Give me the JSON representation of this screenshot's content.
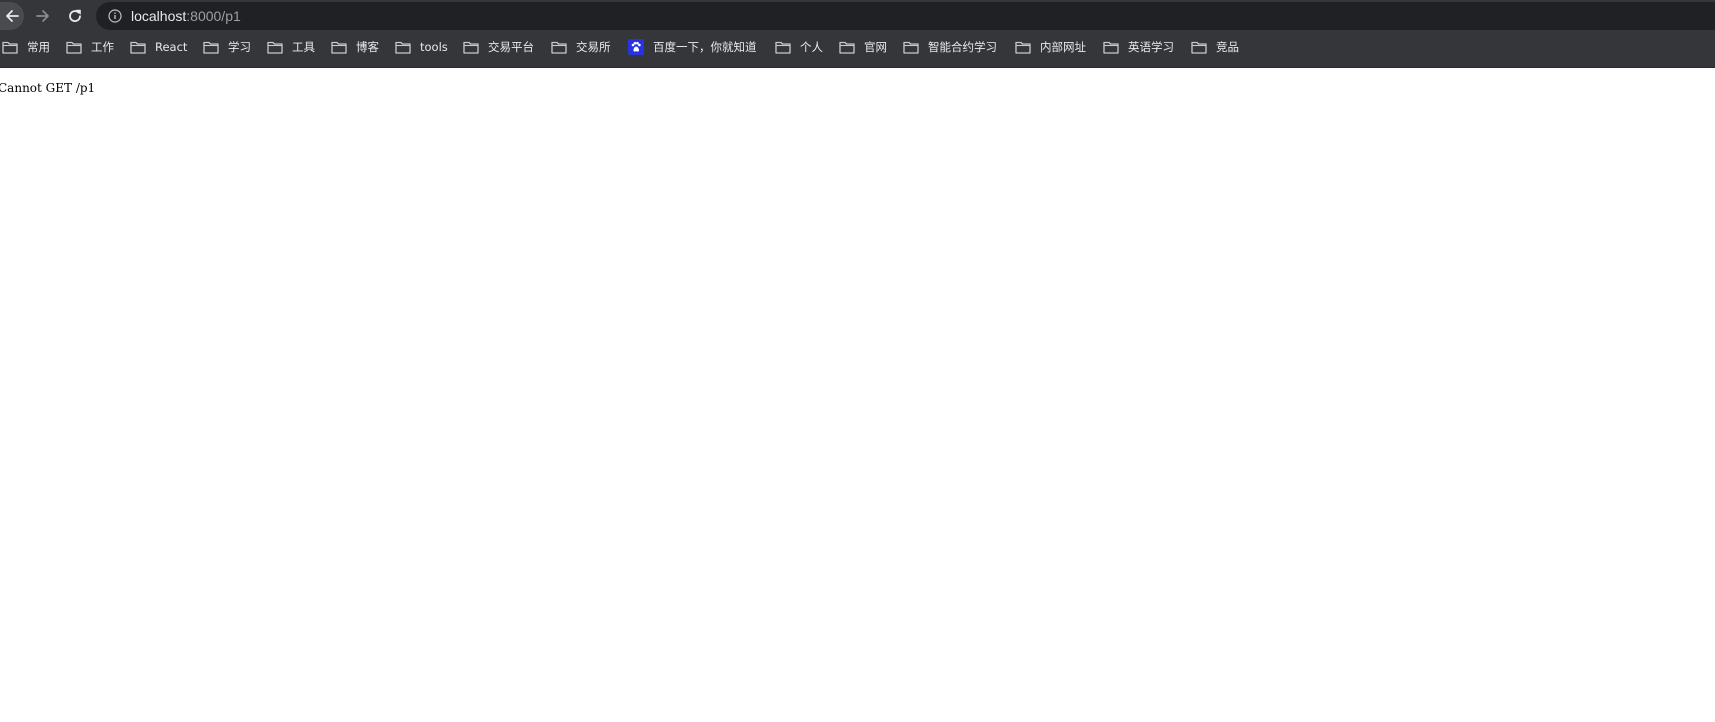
{
  "browser": {
    "address_bar": {
      "host": "localhost",
      "path": ":8000/p1"
    },
    "bookmarks": [
      {
        "label": "常用",
        "icon": "folder-icon"
      },
      {
        "label": "工作",
        "icon": "folder-icon"
      },
      {
        "label": "React",
        "icon": "folder-icon"
      },
      {
        "label": "学习",
        "icon": "folder-icon"
      },
      {
        "label": "工具",
        "icon": "folder-icon"
      },
      {
        "label": "博客",
        "icon": "folder-icon"
      },
      {
        "label": "tools",
        "icon": "folder-icon"
      },
      {
        "label": "交易平台",
        "icon": "folder-icon"
      },
      {
        "label": "交易所",
        "icon": "folder-icon"
      },
      {
        "label": "百度一下，你就知道",
        "icon": "baidu-paw-icon"
      },
      {
        "label": "个人",
        "icon": "folder-icon"
      },
      {
        "label": "官网",
        "icon": "folder-icon"
      },
      {
        "label": "智能合约学习",
        "icon": "folder-icon"
      },
      {
        "label": "内部网址",
        "icon": "folder-icon"
      },
      {
        "label": "英语学习",
        "icon": "folder-icon"
      },
      {
        "label": "竞品",
        "icon": "folder-icon"
      }
    ],
    "colors": {
      "toolbar": "#35363a",
      "omnibox": "#202124",
      "text": "#e8eaed",
      "baidu_blue": "#2932e1"
    }
  },
  "page": {
    "message": "Cannot GET /p1"
  }
}
